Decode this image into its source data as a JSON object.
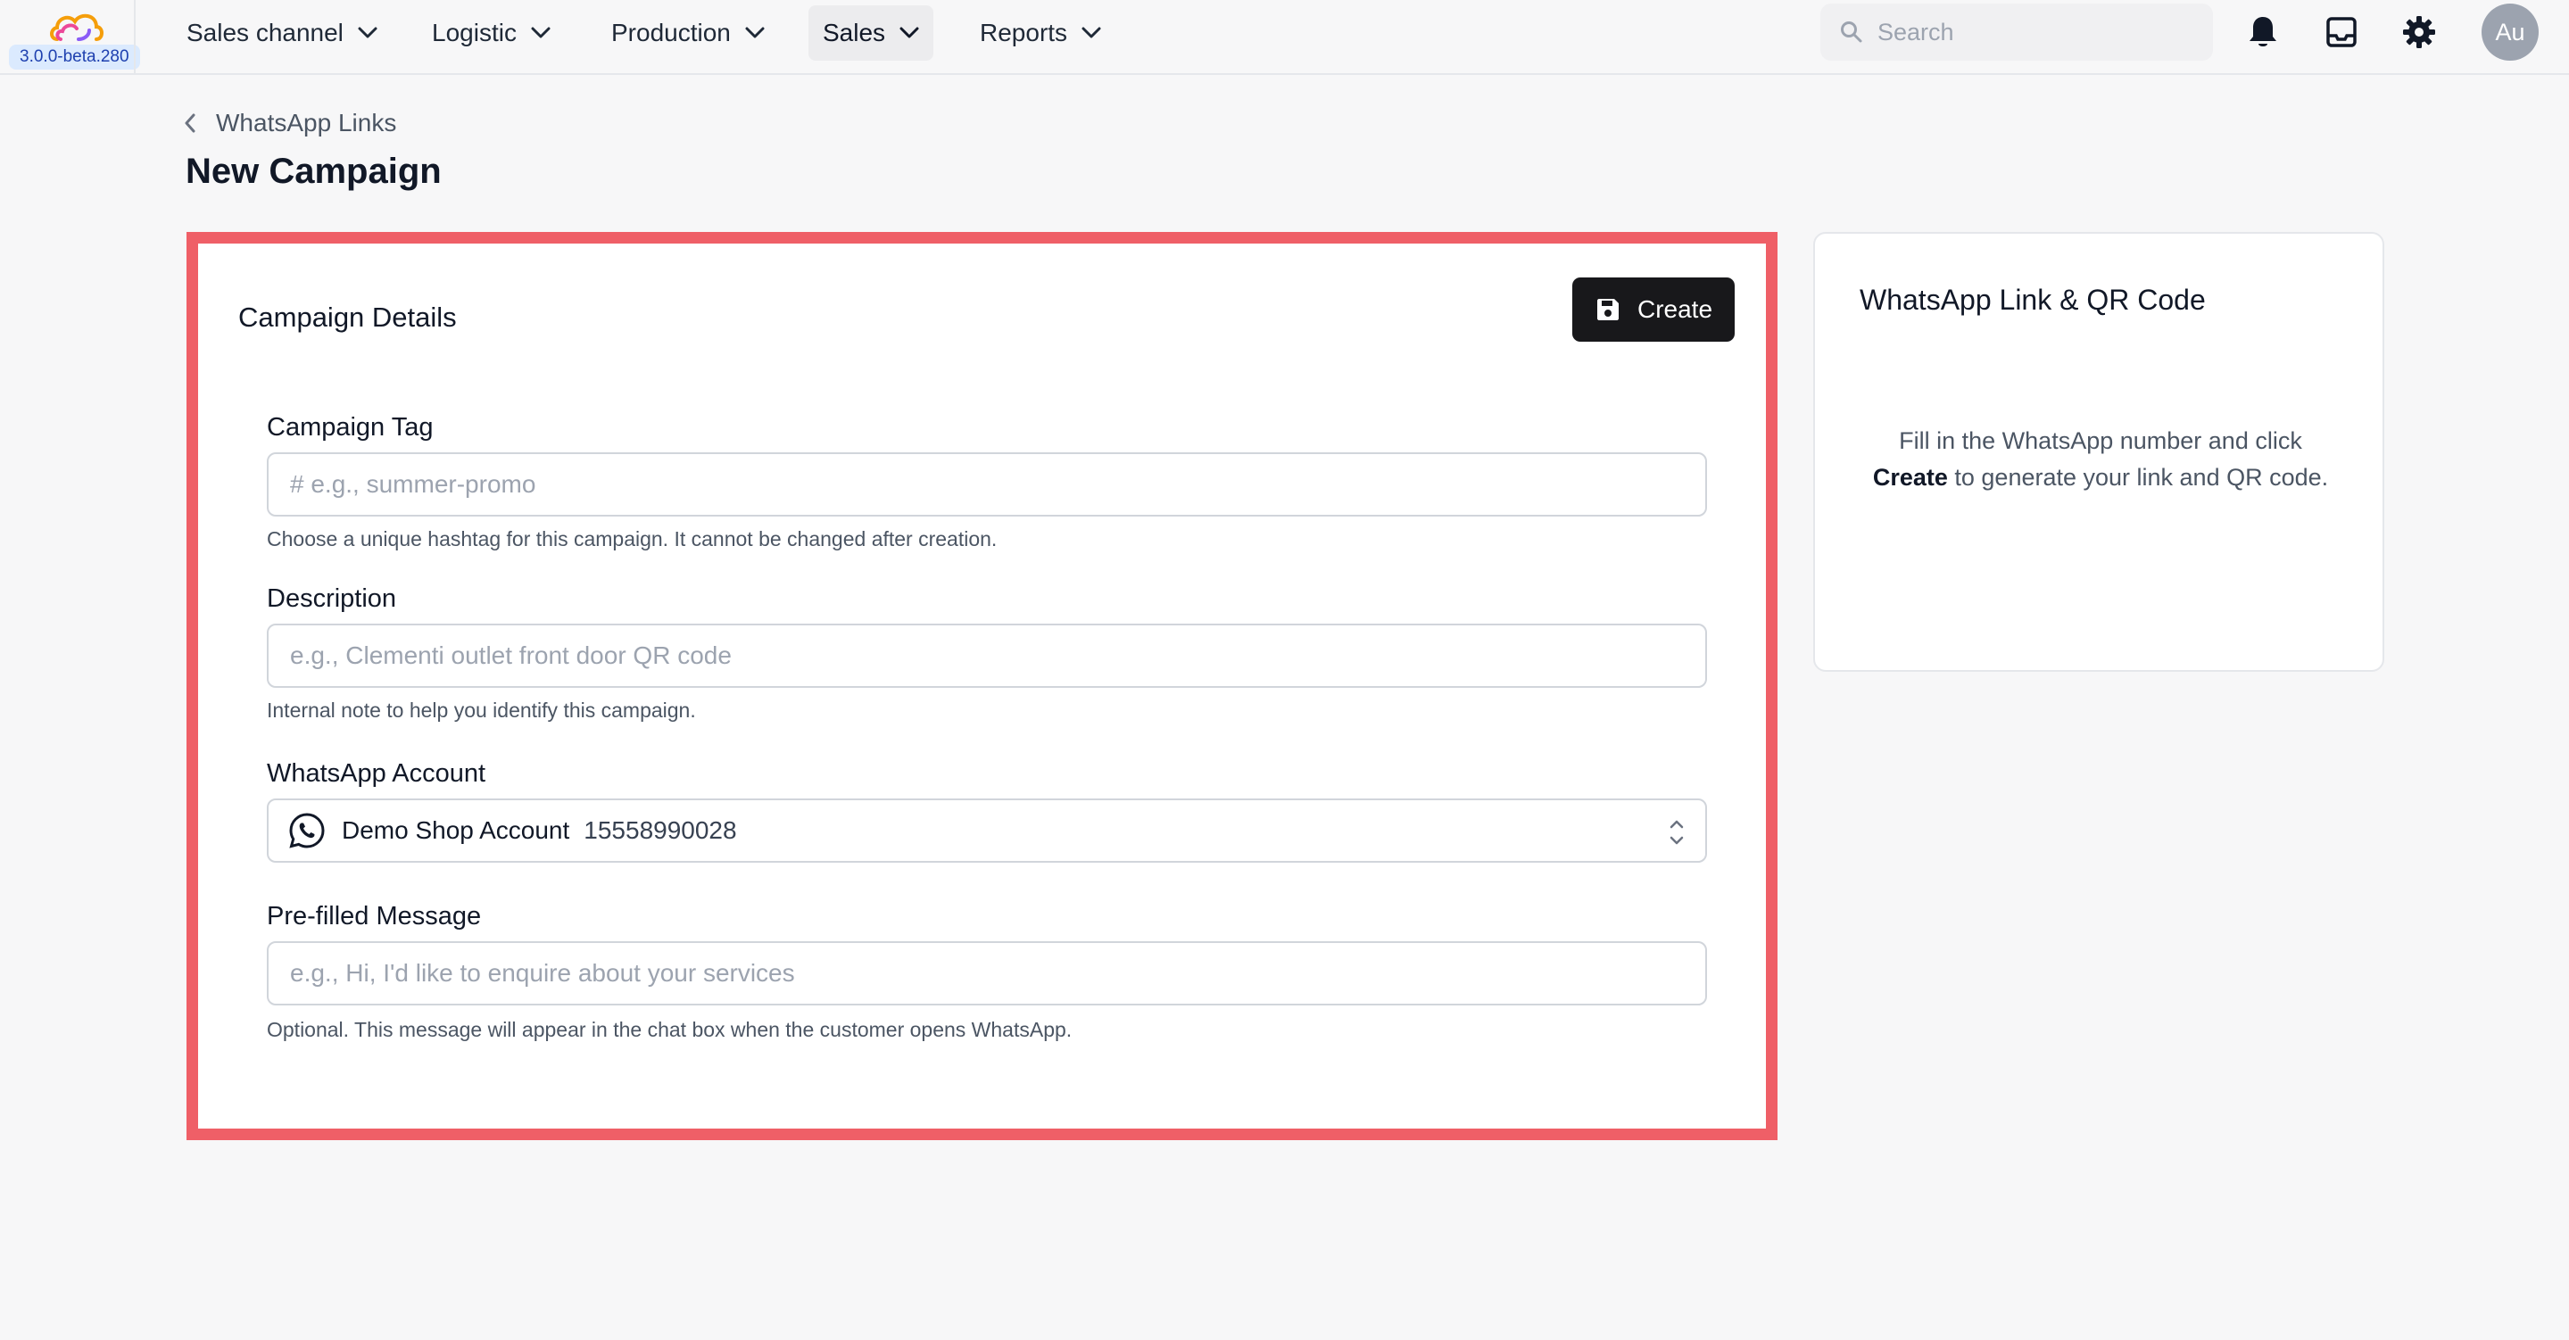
{
  "app": {
    "version": "3.0.0-beta.280"
  },
  "nav": {
    "items": [
      {
        "label": "Sales channel"
      },
      {
        "label": "Logistic"
      },
      {
        "label": "Production"
      },
      {
        "label": "Sales"
      },
      {
        "label": "Reports"
      }
    ],
    "active": "Sales",
    "search_placeholder": "Search",
    "avatar_initials": "Au",
    "icons": [
      "bell-icon",
      "inbox-icon",
      "gear-icon"
    ]
  },
  "header": {
    "breadcrumb": "WhatsApp Links",
    "title": "New Campaign"
  },
  "form": {
    "card_title": "Campaign Details",
    "create_label": "Create",
    "campaign_tag": {
      "label": "Campaign Tag",
      "value": "",
      "placeholder": "# e.g., summer-promo",
      "help": "Choose a unique hashtag for this campaign. It cannot be changed after creation."
    },
    "description": {
      "label": "Description",
      "value": "",
      "placeholder": "e.g., Clementi outlet front door QR code",
      "help": "Internal note to help you identify this campaign."
    },
    "whatsapp_account": {
      "label": "WhatsApp Account",
      "selected_name": "Demo Shop Account",
      "selected_number": "15558990028"
    },
    "prefilled_message": {
      "label": "Pre-filled Message",
      "value": "",
      "placeholder": "e.g., Hi, I'd like to enquire about your services",
      "help": "Optional. This message will appear in the chat box when the customer opens WhatsApp."
    }
  },
  "side": {
    "title": "WhatsApp Link & QR Code",
    "text_before": "Fill in the WhatsApp number and click ",
    "text_bold": "Create",
    "text_after": " to generate your link and QR code."
  },
  "colors": {
    "highlight_border": "#ef5f67",
    "primary_button": "#18181b",
    "version_badge_bg": "#dbeafe"
  }
}
